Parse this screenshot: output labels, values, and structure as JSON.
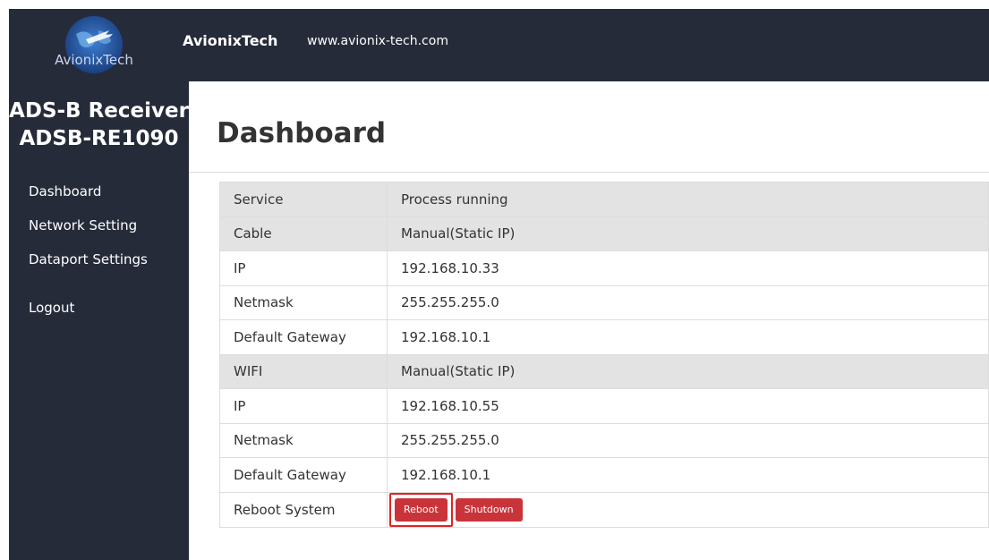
{
  "header": {
    "logo_text": "AvionixTech",
    "brand": "AvionixTech",
    "website": "www.avionix-tech.com"
  },
  "sidebar": {
    "product_line1": "ADS-B Receiver",
    "product_line2": "ADSB-RE1090",
    "items": [
      {
        "label": "Dashboard"
      },
      {
        "label": "Network Setting"
      },
      {
        "label": "Dataport Settings"
      },
      {
        "label": "Logout"
      }
    ]
  },
  "main": {
    "title": "Dashboard",
    "rows": [
      {
        "key": "Service",
        "value": "Process running"
      },
      {
        "key": "Cable",
        "value": "Manual(Static IP)"
      },
      {
        "key": "IP",
        "value": "192.168.10.33"
      },
      {
        "key": "Netmask",
        "value": "255.255.255.0"
      },
      {
        "key": "Default Gateway",
        "value": "192.168.10.1"
      },
      {
        "key": "WIFI",
        "value": "Manual(Static IP)"
      },
      {
        "key": "IP",
        "value": "192.168.10.55"
      },
      {
        "key": "Netmask",
        "value": "255.255.255.0"
      },
      {
        "key": "Default Gateway",
        "value": "192.168.10.1"
      },
      {
        "key": "Reboot System"
      }
    ],
    "reboot_label": "Reboot",
    "shutdown_label": "Shutdown"
  },
  "colors": {
    "dark_bg": "#262b3a",
    "row_highlight": "#e3e3e3",
    "button_red": "#c9343a",
    "highlight_box": "#e02424"
  }
}
